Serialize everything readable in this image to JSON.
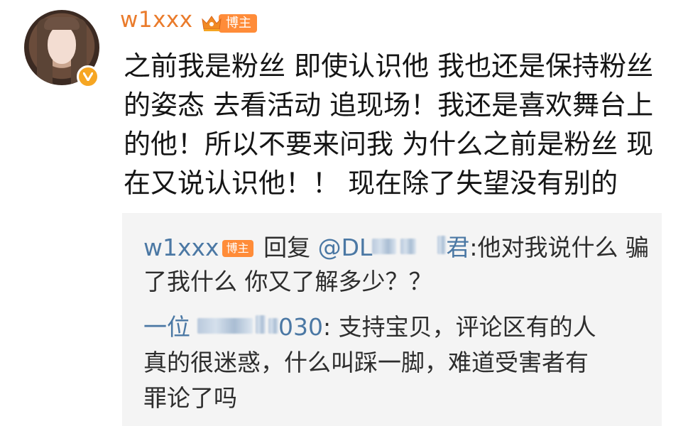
{
  "author": {
    "username": "w1xxx",
    "badge": "博主"
  },
  "post": {
    "text": "之前我是粉丝 即使认识他 我也还是保持粉丝的姿态 去看活动 追现场！我还是喜欢舞台上的他！所以不要来问我 为什么之前是粉丝 现在又说认识他！！ 现在除了失望没有别的"
  },
  "quoted_reply": {
    "author": "w1xxx",
    "badge": "博主",
    "reply_word": "回复",
    "target_prefix": "@DL",
    "target_suffix": "君",
    "text_line1": ":他对我说什么 骗",
    "text_line2": "了我什么 你又了解多少？？"
  },
  "comment": {
    "author_prefix": "一位",
    "author_suffix": "030",
    "text_line1": ": 支持宝贝，评论区有的人",
    "text_line2": "真的很迷惑，什么叫踩一脚，难道受害者有",
    "text_line3": "罪论了吗"
  }
}
